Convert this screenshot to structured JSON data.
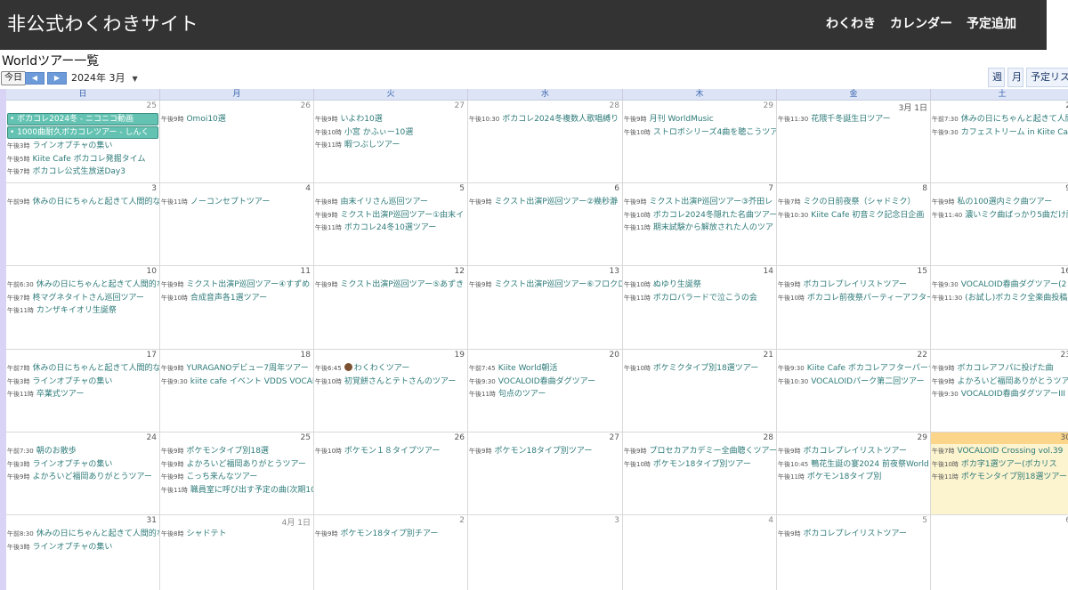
{
  "header": {
    "site_title": "非公式わくわきサイト",
    "nav": [
      "わくわき",
      "カレンダー",
      "予定追加"
    ]
  },
  "page_heading": "Worldツアー一覧",
  "toolbar": {
    "today": "今日",
    "prev_icon": "◀",
    "next_icon": "▶",
    "month": "2024年 3月",
    "views": [
      "週",
      "月",
      "予定リスト"
    ]
  },
  "weekdays": [
    "日",
    "月",
    "火",
    "水",
    "木",
    "金",
    "土"
  ],
  "weeks": [
    [
      {
        "day": "25",
        "other": true,
        "events": [
          {
            "bar": true,
            "text": "ボカコレ2024冬 - ニコニコ動画"
          },
          {
            "bar": true,
            "text": "1000曲耐久ボカコレツアー - しんく"
          },
          {
            "time": "午後3時",
            "text": "ラインオプチャの集い"
          },
          {
            "time": "午後5時",
            "text": "Kiite Cafe ボカコレ発掘タイム"
          },
          {
            "time": "午後7時",
            "text": "ボカコレ公式生放送Day3"
          }
        ]
      },
      {
        "day": "26",
        "other": true,
        "events": [
          {
            "time": "午後9時",
            "text": "Omoi10選"
          }
        ]
      },
      {
        "day": "27",
        "other": true,
        "events": [
          {
            "time": "午後9時",
            "text": "いよわ10選"
          },
          {
            "time": "午後10時",
            "text": "小宮 かふぃー10選"
          },
          {
            "time": "午後11時",
            "text": "暇つぶしツアー"
          }
        ]
      },
      {
        "day": "28",
        "other": true,
        "events": [
          {
            "time": "午後10:30",
            "text": "ボカコレ2024冬複数人歌唱縛り"
          }
        ]
      },
      {
        "day": "29",
        "other": true,
        "events": [
          {
            "time": "午後9時",
            "text": "月刊 WorldMusic"
          },
          {
            "time": "午後10時",
            "text": "ストロボシリーズ4曲を聴こうツア"
          }
        ]
      },
      {
        "day": "3月 1日",
        "events": [
          {
            "time": "午後11:30",
            "text": "花隈千冬誕生日ツアー"
          }
        ]
      },
      {
        "day": "2",
        "events": [
          {
            "time": "午前7:30",
            "text": "休みの日にちゃんと起きて人間"
          },
          {
            "time": "午後9:30",
            "text": "カフェストリーム in Kiite Ca"
          }
        ]
      }
    ],
    [
      {
        "day": "3",
        "events": [
          {
            "time": "午前9時",
            "text": "休みの日にちゃんと起きて人間的な"
          }
        ]
      },
      {
        "day": "4",
        "events": [
          {
            "time": "午後11時",
            "text": "ノーコンセプトツアー"
          }
        ]
      },
      {
        "day": "5",
        "events": [
          {
            "time": "午後8時",
            "text": "由末イリさん巡回ツアー"
          },
          {
            "time": "午後9時",
            "text": "ミクスト出演P巡回ツアー①由末イ"
          },
          {
            "time": "午後11時",
            "text": "ボカコレ24冬10選ツアー"
          }
        ]
      },
      {
        "day": "6",
        "events": [
          {
            "time": "午後9時",
            "text": "ミクスト出演P巡回ツアー②幾秒瀞"
          }
        ]
      },
      {
        "day": "7",
        "events": [
          {
            "time": "午後9時",
            "text": "ミクスト出演P巡回ツアー③芥田レ"
          },
          {
            "time": "午後10時",
            "text": "ボカコレ2024冬隠れた名曲ツアー"
          },
          {
            "time": "午後11時",
            "text": "期末試験から解放された人のツア"
          }
        ]
      },
      {
        "day": "8",
        "events": [
          {
            "time": "午後7時",
            "text": "ミクの日前夜祭（シャドミク）"
          },
          {
            "time": "午後10:30",
            "text": "Kiite Cafe 初音ミク記念日企画"
          }
        ]
      },
      {
        "day": "9",
        "events": [
          {
            "time": "午後9時",
            "text": "私の100選内ミク曲ツアー"
          },
          {
            "time": "午後11:40",
            "text": "濃いミク曲ばっかり5曲だけ耐"
          }
        ]
      }
    ],
    [
      {
        "day": "10",
        "events": [
          {
            "time": "午前6:30",
            "text": "休みの日にちゃんと起きて人間的な"
          },
          {
            "time": "午後7時",
            "text": "柊マグネタイトさん巡回ツアー"
          },
          {
            "time": "午後11時",
            "text": "カンザキイオリ生誕祭"
          }
        ]
      },
      {
        "day": "11",
        "events": [
          {
            "time": "午後9時",
            "text": "ミクスト出演P巡回ツアー④すずめ"
          },
          {
            "time": "午後10時",
            "text": "合成音声各1選ツアー"
          }
        ]
      },
      {
        "day": "12",
        "events": [
          {
            "time": "午後9時",
            "text": "ミクスト出演P巡回ツアー⑤あずき"
          }
        ]
      },
      {
        "day": "13",
        "events": [
          {
            "time": "午後9時",
            "text": "ミクスト出演P巡回ツアー⑥フロクロ"
          }
        ]
      },
      {
        "day": "14",
        "events": [
          {
            "time": "午後10時",
            "text": "ぬゆり生誕祭"
          },
          {
            "time": "午後11時",
            "text": "ボカロバラードで泣こうの会"
          }
        ]
      },
      {
        "day": "15",
        "events": [
          {
            "time": "午後9時",
            "text": "ボカコレプレイリストツアー"
          },
          {
            "time": "午後10時",
            "text": "ボカコレ前夜祭パーティーアフター"
          }
        ]
      },
      {
        "day": "16",
        "events": [
          {
            "time": "午後9:30",
            "text": "VOCALOID春曲ダグツアー(2"
          },
          {
            "time": "午後11:30",
            "text": "(お試し)ボカミク全楽曲投稿"
          }
        ]
      }
    ],
    [
      {
        "day": "17",
        "events": [
          {
            "time": "午前7時",
            "text": "休みの日にちゃんと起きて人間的な"
          },
          {
            "time": "午後3時",
            "text": "ラインオプチャの集い"
          },
          {
            "time": "午後11時",
            "text": "卒業式ツアー"
          }
        ]
      },
      {
        "day": "18",
        "events": [
          {
            "time": "午後9時",
            "text": "YURAGANOデビュー7周年ツアー"
          },
          {
            "time": "午後9:30",
            "text": "kiite cafe イベント VDDS VOCAL"
          }
        ]
      },
      {
        "day": "19",
        "events": [
          {
            "time": "午後6:45",
            "emoji": true,
            "text": "わくわくツアー"
          },
          {
            "time": "午後10時",
            "text": "初覚餅さんとテトさんのツアー"
          }
        ]
      },
      {
        "day": "20",
        "events": [
          {
            "time": "午前7:45",
            "text": "Kiite World朝活"
          },
          {
            "time": "午後9:30",
            "text": "VOCALOID春曲ダグツアー"
          },
          {
            "time": "午後11時",
            "text": "句点のツアー"
          }
        ]
      },
      {
        "day": "21",
        "events": [
          {
            "time": "午後10時",
            "text": "ボケミクタイプ別18選ツアー"
          }
        ]
      },
      {
        "day": "22",
        "events": [
          {
            "time": "午後9:30",
            "text": "Kiite Cafe ボカコレアフターパーテ"
          },
          {
            "time": "午後10:30",
            "text": "VOCALOIDパーク第二回ツアー"
          }
        ]
      },
      {
        "day": "23",
        "events": [
          {
            "time": "午後9時",
            "text": "ボカコレアフパに投げた曲"
          },
          {
            "time": "午後9時",
            "text": "よかろいど福岡ありがとうツアー"
          },
          {
            "time": "午後9:30",
            "text": "VOCALOID春曲ダグツアーIII"
          }
        ]
      }
    ],
    [
      {
        "day": "24",
        "events": [
          {
            "time": "午前7:30",
            "text": "朝のお散歩"
          },
          {
            "time": "午後3時",
            "text": "ラインオプチャの集い"
          },
          {
            "time": "午後9時",
            "text": "よかろいど福岡ありがとうツアー"
          }
        ]
      },
      {
        "day": "25",
        "events": [
          {
            "time": "午後9時",
            "text": "ポケモンタイプ別18選"
          },
          {
            "time": "午後9時",
            "text": "よかろいど福岡ありがとうツアー"
          },
          {
            "time": "午後9時",
            "text": "こっち来んなツアー"
          },
          {
            "time": "午後11時",
            "text": "職員室に呼び出す予定の曲(次期10"
          }
        ]
      },
      {
        "day": "26",
        "events": [
          {
            "time": "午後10時",
            "text": "ポケモン１８タイプツアー"
          }
        ]
      },
      {
        "day": "27",
        "events": [
          {
            "time": "午後9時",
            "text": "ポケモン18タイプ別ツアー"
          }
        ]
      },
      {
        "day": "28",
        "events": [
          {
            "time": "午後9時",
            "text": "プロセカアカデミー全曲聴くツアー"
          },
          {
            "time": "午後10時",
            "text": "ポケモン18タイプ別ツアー"
          }
        ]
      },
      {
        "day": "29",
        "events": [
          {
            "time": "午後9時",
            "text": "ボカコレプレイリストツアー"
          },
          {
            "time": "午後10:45",
            "text": "鴨花生誕の宴2024 前夜祭World ツ"
          },
          {
            "time": "午後11時",
            "text": "ポケモン18タイプ別"
          }
        ]
      },
      {
        "day": "30",
        "today": true,
        "events": [
          {
            "time": "午後7時",
            "text": "VOCALOID Crossing vol.39"
          },
          {
            "time": "午後10時",
            "text": "ボカ字1選ツアー(ボカリス"
          },
          {
            "time": "午後11時",
            "text": "ポケモンタイプ別18選ツアー"
          }
        ]
      }
    ],
    [
      {
        "day": "31",
        "events": [
          {
            "time": "午前8:30",
            "text": "休みの日にちゃんと起きて人間的な"
          },
          {
            "time": "午後3時",
            "text": "ラインオプチャの集い"
          }
        ]
      },
      {
        "day": "4月 1日",
        "other": true,
        "events": [
          {
            "time": "午後8時",
            "text": "シャドテト"
          }
        ]
      },
      {
        "day": "2",
        "other": true,
        "events": [
          {
            "time": "午後9時",
            "text": "ポケモン18タイプ別チアー"
          }
        ]
      },
      {
        "day": "3",
        "other": true,
        "events": []
      },
      {
        "day": "4",
        "other": true,
        "events": []
      },
      {
        "day": "5",
        "other": true,
        "events": [
          {
            "time": "午後9時",
            "text": "ボカコレプレイリストツアー"
          }
        ]
      },
      {
        "day": "6",
        "other": true,
        "events": []
      }
    ]
  ],
  "colors": {
    "topbar": "#333333",
    "event_text": "#2c7a78",
    "event_bar": "#63c2b1",
    "today_bg": "#fcf3cf",
    "header_row": "#dde4f5"
  }
}
